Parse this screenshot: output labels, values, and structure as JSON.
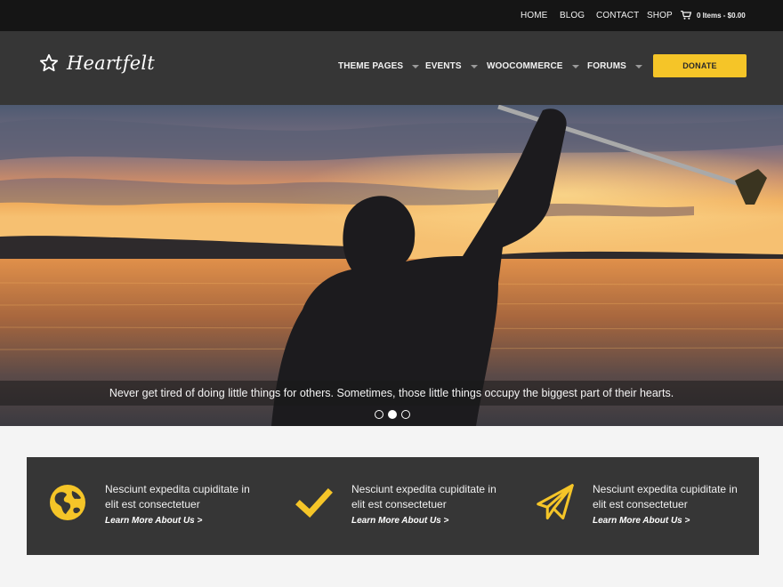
{
  "topbar": {
    "links": [
      "HOME",
      "BLOG",
      "CONTACT",
      "SHOP"
    ],
    "cart_label": "0 Items - $0.00"
  },
  "header": {
    "logo_text": "Heartfelt",
    "nav": [
      "THEME PAGES",
      "EVENTS",
      "WOOCOMMERCE",
      "FORUMS"
    ],
    "donate_label": "DONATE"
  },
  "hero": {
    "caption": "Never get tired of doing little things for others. Sometimes, those little things occupy the biggest part of their hearts.",
    "slides": 3,
    "active_slide": 2
  },
  "features": [
    {
      "icon": "globe-icon",
      "text": "Nesciunt expedita cupiditate in elit est consectetuer",
      "link": "Learn More About Us >"
    },
    {
      "icon": "checkmark-icon",
      "text": "Nesciunt expedita cupiditate in elit est consectetuer",
      "link": "Learn More About Us >"
    },
    {
      "icon": "paper-plane-icon",
      "text": "Nesciunt expedita cupiditate in elit est consectetuer",
      "link": "Learn More About Us >"
    }
  ],
  "colors": {
    "accent": "#f5c528",
    "topbar": "#151515",
    "header": "#363636",
    "features_bg": "#363636"
  }
}
